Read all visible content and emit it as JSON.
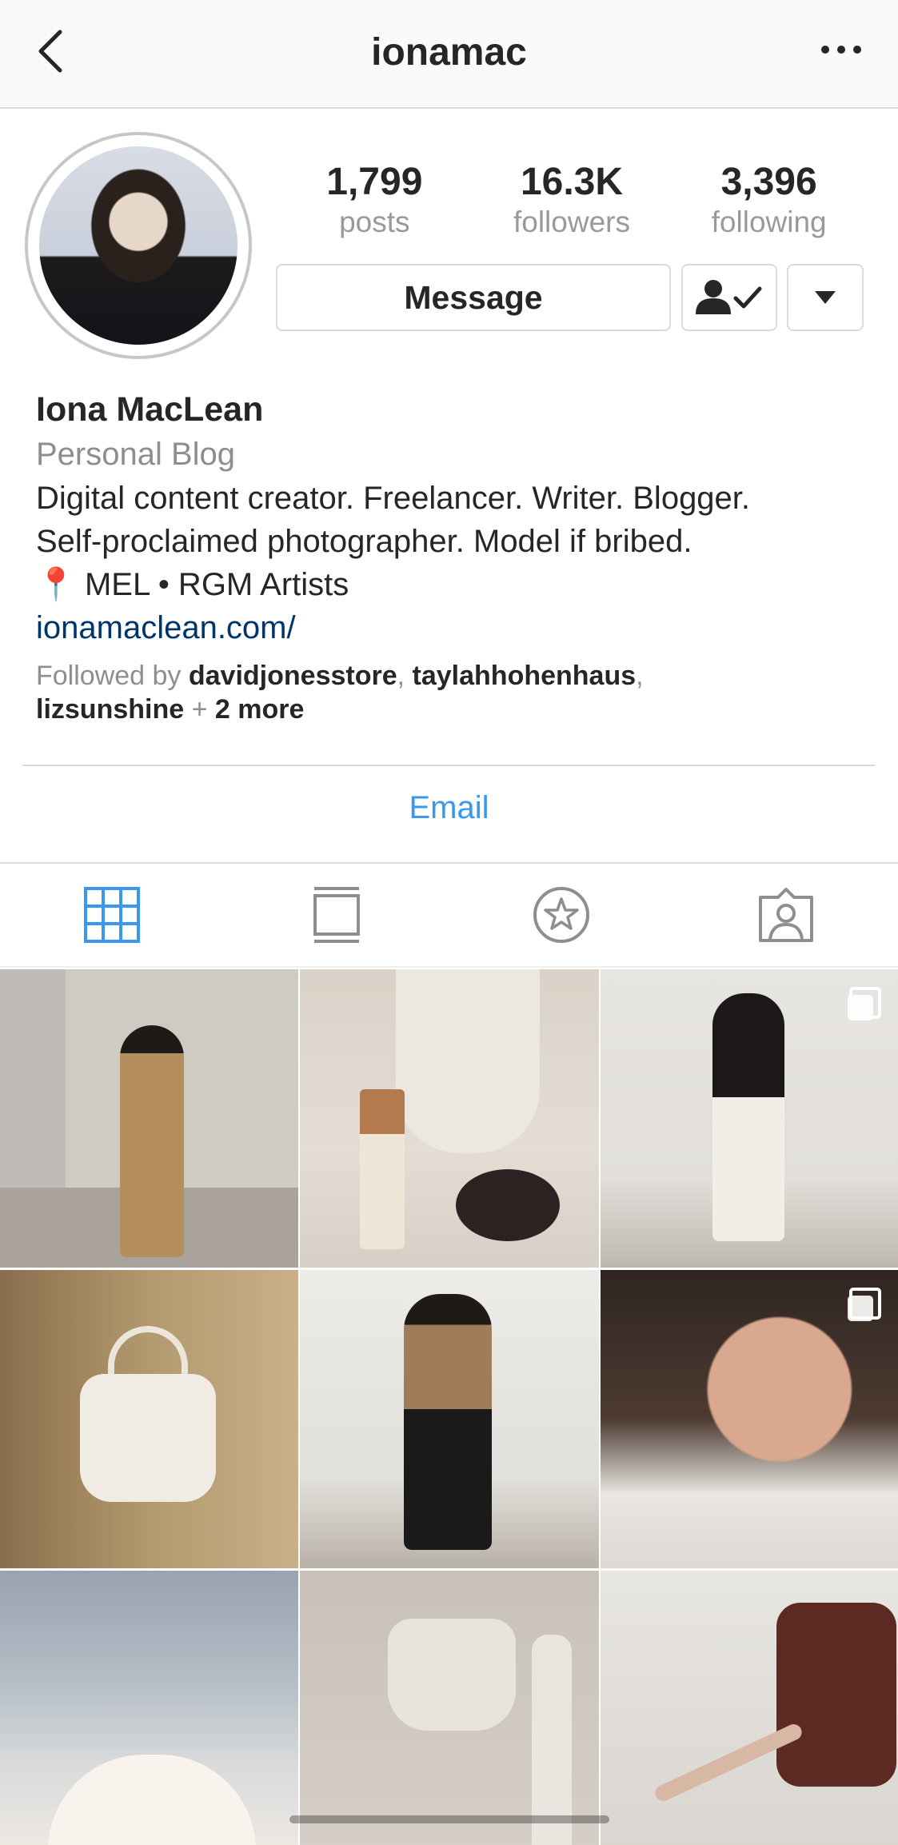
{
  "nav": {
    "title": "ionamac"
  },
  "stats": [
    {
      "value": "1,799",
      "label": "posts"
    },
    {
      "value": "16.3K",
      "label": "followers"
    },
    {
      "value": "3,396",
      "label": "following"
    }
  ],
  "actions": {
    "message_label": "Message"
  },
  "bio": {
    "name": "Iona MacLean",
    "category": "Personal Blog",
    "line1": "Digital content creator. Freelancer. Writer. Blogger.",
    "line2": "Self-proclaimed photographer. Model if bribed.",
    "location_emoji": "📍",
    "location_text": "MEL • RGM Artists",
    "website": "ionamaclean.com/",
    "followed_prefix": "Followed by",
    "followed_user1": "davidjonesstore",
    "followed_sep1": ", ",
    "followed_user2": "taylahhohenhaus",
    "followed_sep2": ",",
    "followed_user3": "lizsunshine",
    "followed_plus": " + ",
    "followed_more": "2 more"
  },
  "contact": {
    "email_label": "Email"
  },
  "tabs": [
    {
      "name": "grid",
      "active": true
    },
    {
      "name": "feed",
      "active": false
    },
    {
      "name": "saved",
      "active": false
    },
    {
      "name": "tagged",
      "active": false
    }
  ],
  "colors": {
    "accent_blue": "#3897f0",
    "link_dark_blue": "#003569",
    "secondary_text": "#999999",
    "border": "#dbdbdb"
  },
  "posts": [
    {
      "id": 1,
      "multi": false
    },
    {
      "id": 2,
      "multi": false
    },
    {
      "id": 3,
      "multi": true
    },
    {
      "id": 4,
      "multi": false
    },
    {
      "id": 5,
      "multi": false
    },
    {
      "id": 6,
      "multi": true
    },
    {
      "id": 7,
      "multi": false
    },
    {
      "id": 8,
      "multi": false
    },
    {
      "id": 9,
      "multi": false
    }
  ]
}
